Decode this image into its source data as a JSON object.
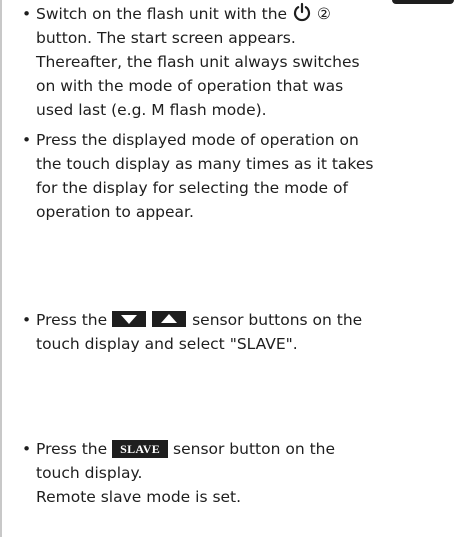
{
  "bullet": "•",
  "items": [
    {
      "lines": [
        {
          "before": "Switch on the flash unit with the",
          "after": "button. The start screen appears."
        },
        "Thereafter, the flash unit always switches",
        "on with the mode of operation that was",
        "used last (e.g. M flash mode)."
      ],
      "icon": "power-icon",
      "circled_number": "②"
    },
    {
      "lines": [
        "Press the displayed mode of operation on",
        "the touch display as many times as it takes",
        "for the display for selecting the mode of",
        "operation to appear."
      ]
    },
    {
      "lead": "Press the",
      "tail": "sensor buttons on the",
      "line2": "touch display and select \"SLAVE\".",
      "icons": [
        "arrow-down-sensor-icon",
        "arrow-up-sensor-icon"
      ]
    },
    {
      "lead": "Press the",
      "button_label": "SLAVE",
      "tail": "sensor button on the",
      "line2": "touch display.",
      "line3": "Remote slave mode is set."
    }
  ]
}
